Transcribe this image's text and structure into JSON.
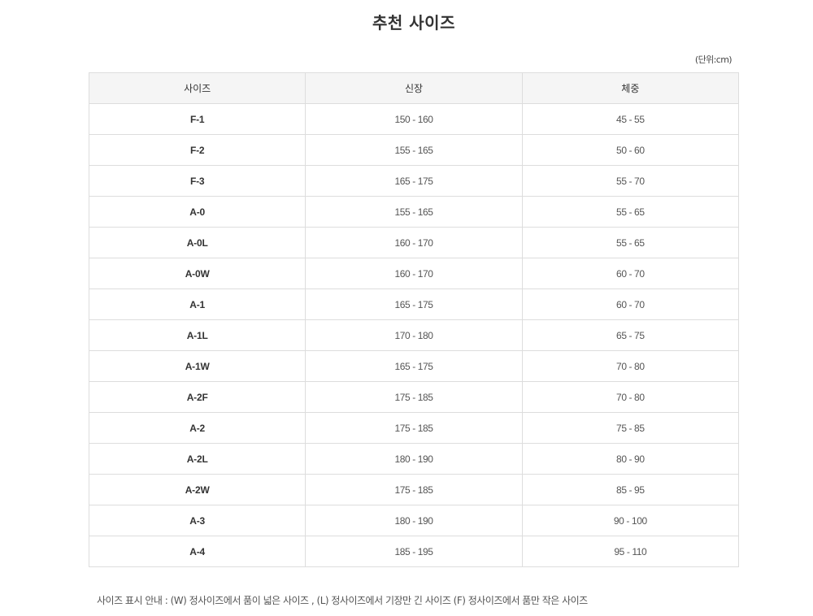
{
  "title": "추천 사이즈",
  "unit": "(단위:cm)",
  "table": {
    "headers": [
      "사이즈",
      "신장",
      "체중"
    ],
    "rows": [
      {
        "size": "F-1",
        "height": "150 - 160",
        "weight": "45 - 55"
      },
      {
        "size": "F-2",
        "height": "155 - 165",
        "weight": "50 - 60"
      },
      {
        "size": "F-3",
        "height": "165 - 175",
        "weight": "55 - 70"
      },
      {
        "size": "A-0",
        "height": "155 - 165",
        "weight": "55 - 65"
      },
      {
        "size": "A-0L",
        "height": "160 - 170",
        "weight": "55 - 65"
      },
      {
        "size": "A-0W",
        "height": "160 - 170",
        "weight": "60 - 70"
      },
      {
        "size": "A-1",
        "height": "165 - 175",
        "weight": "60 - 70"
      },
      {
        "size": "A-1L",
        "height": "170 - 180",
        "weight": "65 - 75"
      },
      {
        "size": "A-1W",
        "height": "165 - 175",
        "weight": "70 - 80"
      },
      {
        "size": "A-2F",
        "height": "175 - 185",
        "weight": "70 - 80"
      },
      {
        "size": "A-2",
        "height": "175 - 185",
        "weight": "75 - 85"
      },
      {
        "size": "A-2L",
        "height": "180 - 190",
        "weight": "80 - 90"
      },
      {
        "size": "A-2W",
        "height": "175 - 185",
        "weight": "85 - 95"
      },
      {
        "size": "A-3",
        "height": "180 - 190",
        "weight": "90 - 100"
      },
      {
        "size": "A-4",
        "height": "185 - 195",
        "weight": "95 - 110"
      }
    ]
  },
  "footnote": "사이즈 표시 안내 : (W) 정사이즈에서 품이 넓은 사이즈 , (L) 정사이즈에서 기장만 긴 사이즈 (F) 정사이즈에서 품만 작은 사이즈"
}
